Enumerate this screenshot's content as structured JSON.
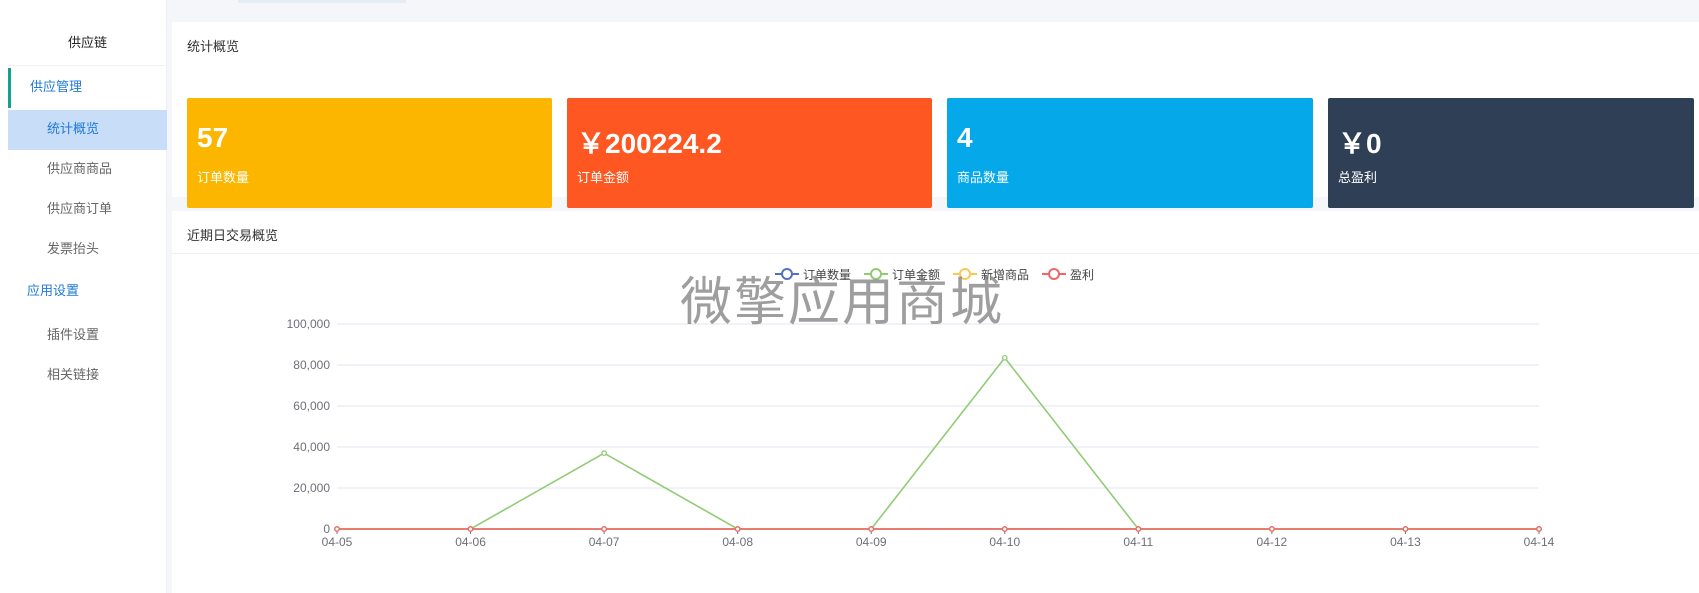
{
  "sidebar": {
    "title": "供应链",
    "groups": [
      {
        "label": "供应管理",
        "items": [
          "统计概览",
          "供应商商品",
          "供应商订单",
          "发票抬头"
        ]
      },
      {
        "label": "应用设置",
        "items": [
          "插件设置",
          "相关链接"
        ]
      }
    ],
    "selected": "统计概览"
  },
  "stats": {
    "title": "统计概览",
    "cards": [
      {
        "value": "57",
        "label": "订单数量",
        "color": "#fdb600"
      },
      {
        "value": "￥200224.2",
        "label": "订单金额",
        "color": "#ff5722"
      },
      {
        "value": "4",
        "label": "商品数量",
        "color": "#05a9ea"
      },
      {
        "value": "￥0",
        "label": "总盈利",
        "color": "#2f3f55"
      }
    ]
  },
  "trend": {
    "title": "近期日交易概览",
    "legend": [
      {
        "name": "订单数量",
        "color": "#5470c6"
      },
      {
        "name": "订单金额",
        "color": "#91cc75"
      },
      {
        "name": "新增商品",
        "color": "#fac858"
      },
      {
        "name": "盈利",
        "color": "#ee6666"
      }
    ]
  },
  "watermark": "微擎应用商城",
  "chart_data": {
    "type": "line",
    "categories": [
      "04-05",
      "04-06",
      "04-07",
      "04-08",
      "04-09",
      "04-10",
      "04-11",
      "04-12",
      "04-13",
      "04-14"
    ],
    "ylim": [
      0,
      100000
    ],
    "yticks": [
      "0",
      "20,000",
      "40,000",
      "60,000",
      "80,000",
      "100,000"
    ],
    "grid": true,
    "legend_position": "top-center",
    "series": [
      {
        "name": "订单数量",
        "color": "#5470c6",
        "values": [
          0,
          0,
          4,
          0,
          0,
          9,
          0,
          0,
          0,
          0
        ]
      },
      {
        "name": "订单金额",
        "color": "#91cc75",
        "values": [
          0,
          0,
          37000,
          0,
          0,
          83500,
          0,
          0,
          0,
          0
        ]
      },
      {
        "name": "新增商品",
        "color": "#fac858",
        "values": [
          0,
          0,
          0,
          0,
          0,
          0,
          0,
          0,
          0,
          0
        ]
      },
      {
        "name": "盈利",
        "color": "#ee6666",
        "values": [
          0,
          0,
          0,
          0,
          0,
          0,
          0,
          0,
          0,
          0
        ]
      }
    ]
  }
}
